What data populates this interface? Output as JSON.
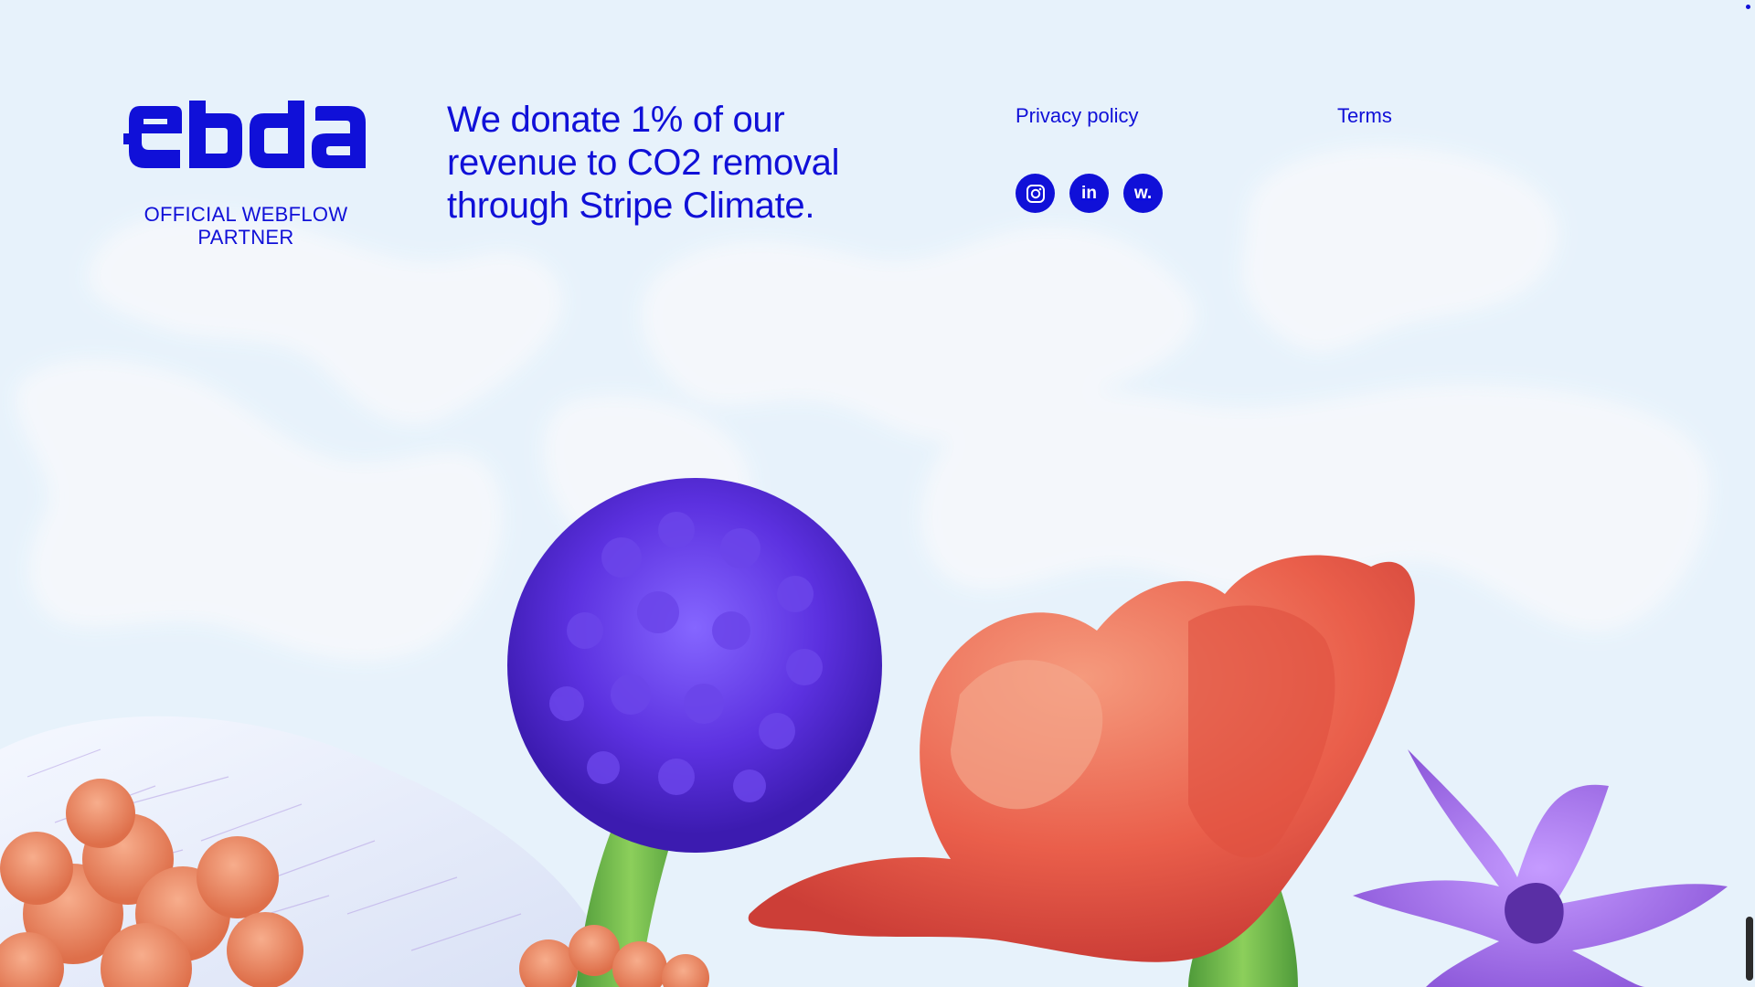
{
  "brand": {
    "logo_text": "ebda",
    "partner_badge": "OFFICIAL WEBFLOW PARTNER",
    "accent_color": "#1010d8"
  },
  "footer": {
    "tagline": "We donate 1% of our revenue to CO2 removal through Stripe Climate.",
    "privacy_label": "Privacy policy",
    "terms_label": "Terms",
    "socials": [
      {
        "name": "instagram",
        "icon": "instagram-icon"
      },
      {
        "name": "linkedin",
        "icon": "linkedin-icon",
        "glyph": "in"
      },
      {
        "name": "webflow",
        "icon": "webflow-icon",
        "glyph": "w."
      }
    ]
  },
  "colors": {
    "background": "#e7f2fb",
    "cloud": "#f4f7fb",
    "flower_purple": "#6b3fe0",
    "flower_red": "#e8604a",
    "flower_violet": "#a774e8",
    "stem_green": "#6fb04a",
    "coral_orange": "#ea8a63"
  }
}
